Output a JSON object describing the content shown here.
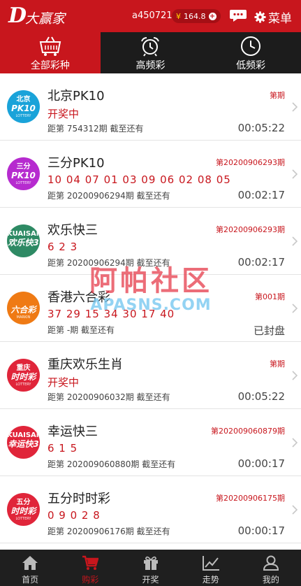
{
  "header": {
    "logo_mark": "D",
    "logo_text": "大赢家",
    "username": "a450721",
    "balance_symbol": "¥",
    "balance": "164.8",
    "menu_label": "菜单"
  },
  "tabs": [
    {
      "label": "全部彩种",
      "active": true
    },
    {
      "label": "高频彩",
      "active": false
    },
    {
      "label": "低频彩",
      "active": false
    }
  ],
  "lotteries": [
    {
      "name": "北京PK10",
      "period": "第期",
      "result": "开奖中",
      "next_text": "距第 754312期 截至还有",
      "countdown": "00:05:22",
      "icon": {
        "l1": "北京",
        "l2": "PK10",
        "l3": "LOTTERY",
        "color": "#1aa3d9"
      }
    },
    {
      "name": "三分PK10",
      "period": "第20200906293期",
      "result": "10 04 07 01 03 09 06 02 08 05",
      "next_text": "距第 20200906294期 截至还有",
      "countdown": "00:02:17",
      "icon": {
        "l1": "三分",
        "l2": "PK10",
        "l3": "LOTTERY",
        "color": "#b62bcf"
      }
    },
    {
      "name": "欢乐快三",
      "period": "第20200906293期",
      "result": "6 2 3",
      "next_text": "距第 20200906294期 截至还有",
      "countdown": "00:02:17",
      "icon": {
        "l1": "KUAISAN",
        "l2": "欢乐快3",
        "l3": "",
        "color": "#2e8a64"
      }
    },
    {
      "name": "香港六合彩",
      "period": "第001期",
      "result": "37 29 15 34 30 17 40",
      "next_text": "距第 -期 截至还有",
      "countdown": "已封盘",
      "icon": {
        "l1": "",
        "l2": "六合彩",
        "l3": "MARKIN",
        "color": "#ef7a14"
      }
    },
    {
      "name": "重庆欢乐生肖",
      "period": "第期",
      "result": "开奖中",
      "next_text": "距第 20200906032期 截至还有",
      "countdown": "00:05:22",
      "icon": {
        "l1": "重庆",
        "l2": "时时彩",
        "l3": "LOTTERY",
        "color": "#e0253a"
      }
    },
    {
      "name": "幸运快三",
      "period": "第202009060879期",
      "result": "6 1 5",
      "next_text": "距第 202009060880期 截至还有",
      "countdown": "00:00:17",
      "icon": {
        "l1": "KUAISAN",
        "l2": "幸运快3",
        "l3": "",
        "color": "#e0253a"
      }
    },
    {
      "name": "五分时时彩",
      "period": "第20200906175期",
      "result": "0 9 0 2 8",
      "next_text": "距第 20200906176期 截至还有",
      "countdown": "00:00:17",
      "icon": {
        "l1": "五分",
        "l2": "时时彩",
        "l3": "LOTTERY",
        "color": "#e0253a"
      }
    }
  ],
  "watermark": {
    "line1": "阿帕社区",
    "line2": "APASNS.COM"
  },
  "bottom_nav": [
    {
      "label": "首页",
      "icon": "home-icon",
      "active": false
    },
    {
      "label": "购彩",
      "icon": "cart-icon",
      "active": true
    },
    {
      "label": "开奖",
      "icon": "gift-icon",
      "active": false
    },
    {
      "label": "走势",
      "icon": "trend-icon",
      "active": false
    },
    {
      "label": "我的",
      "icon": "user-icon",
      "active": false
    }
  ],
  "colors": {
    "brand_red": "#c8161d",
    "dark_bar": "#1c1c1c"
  }
}
